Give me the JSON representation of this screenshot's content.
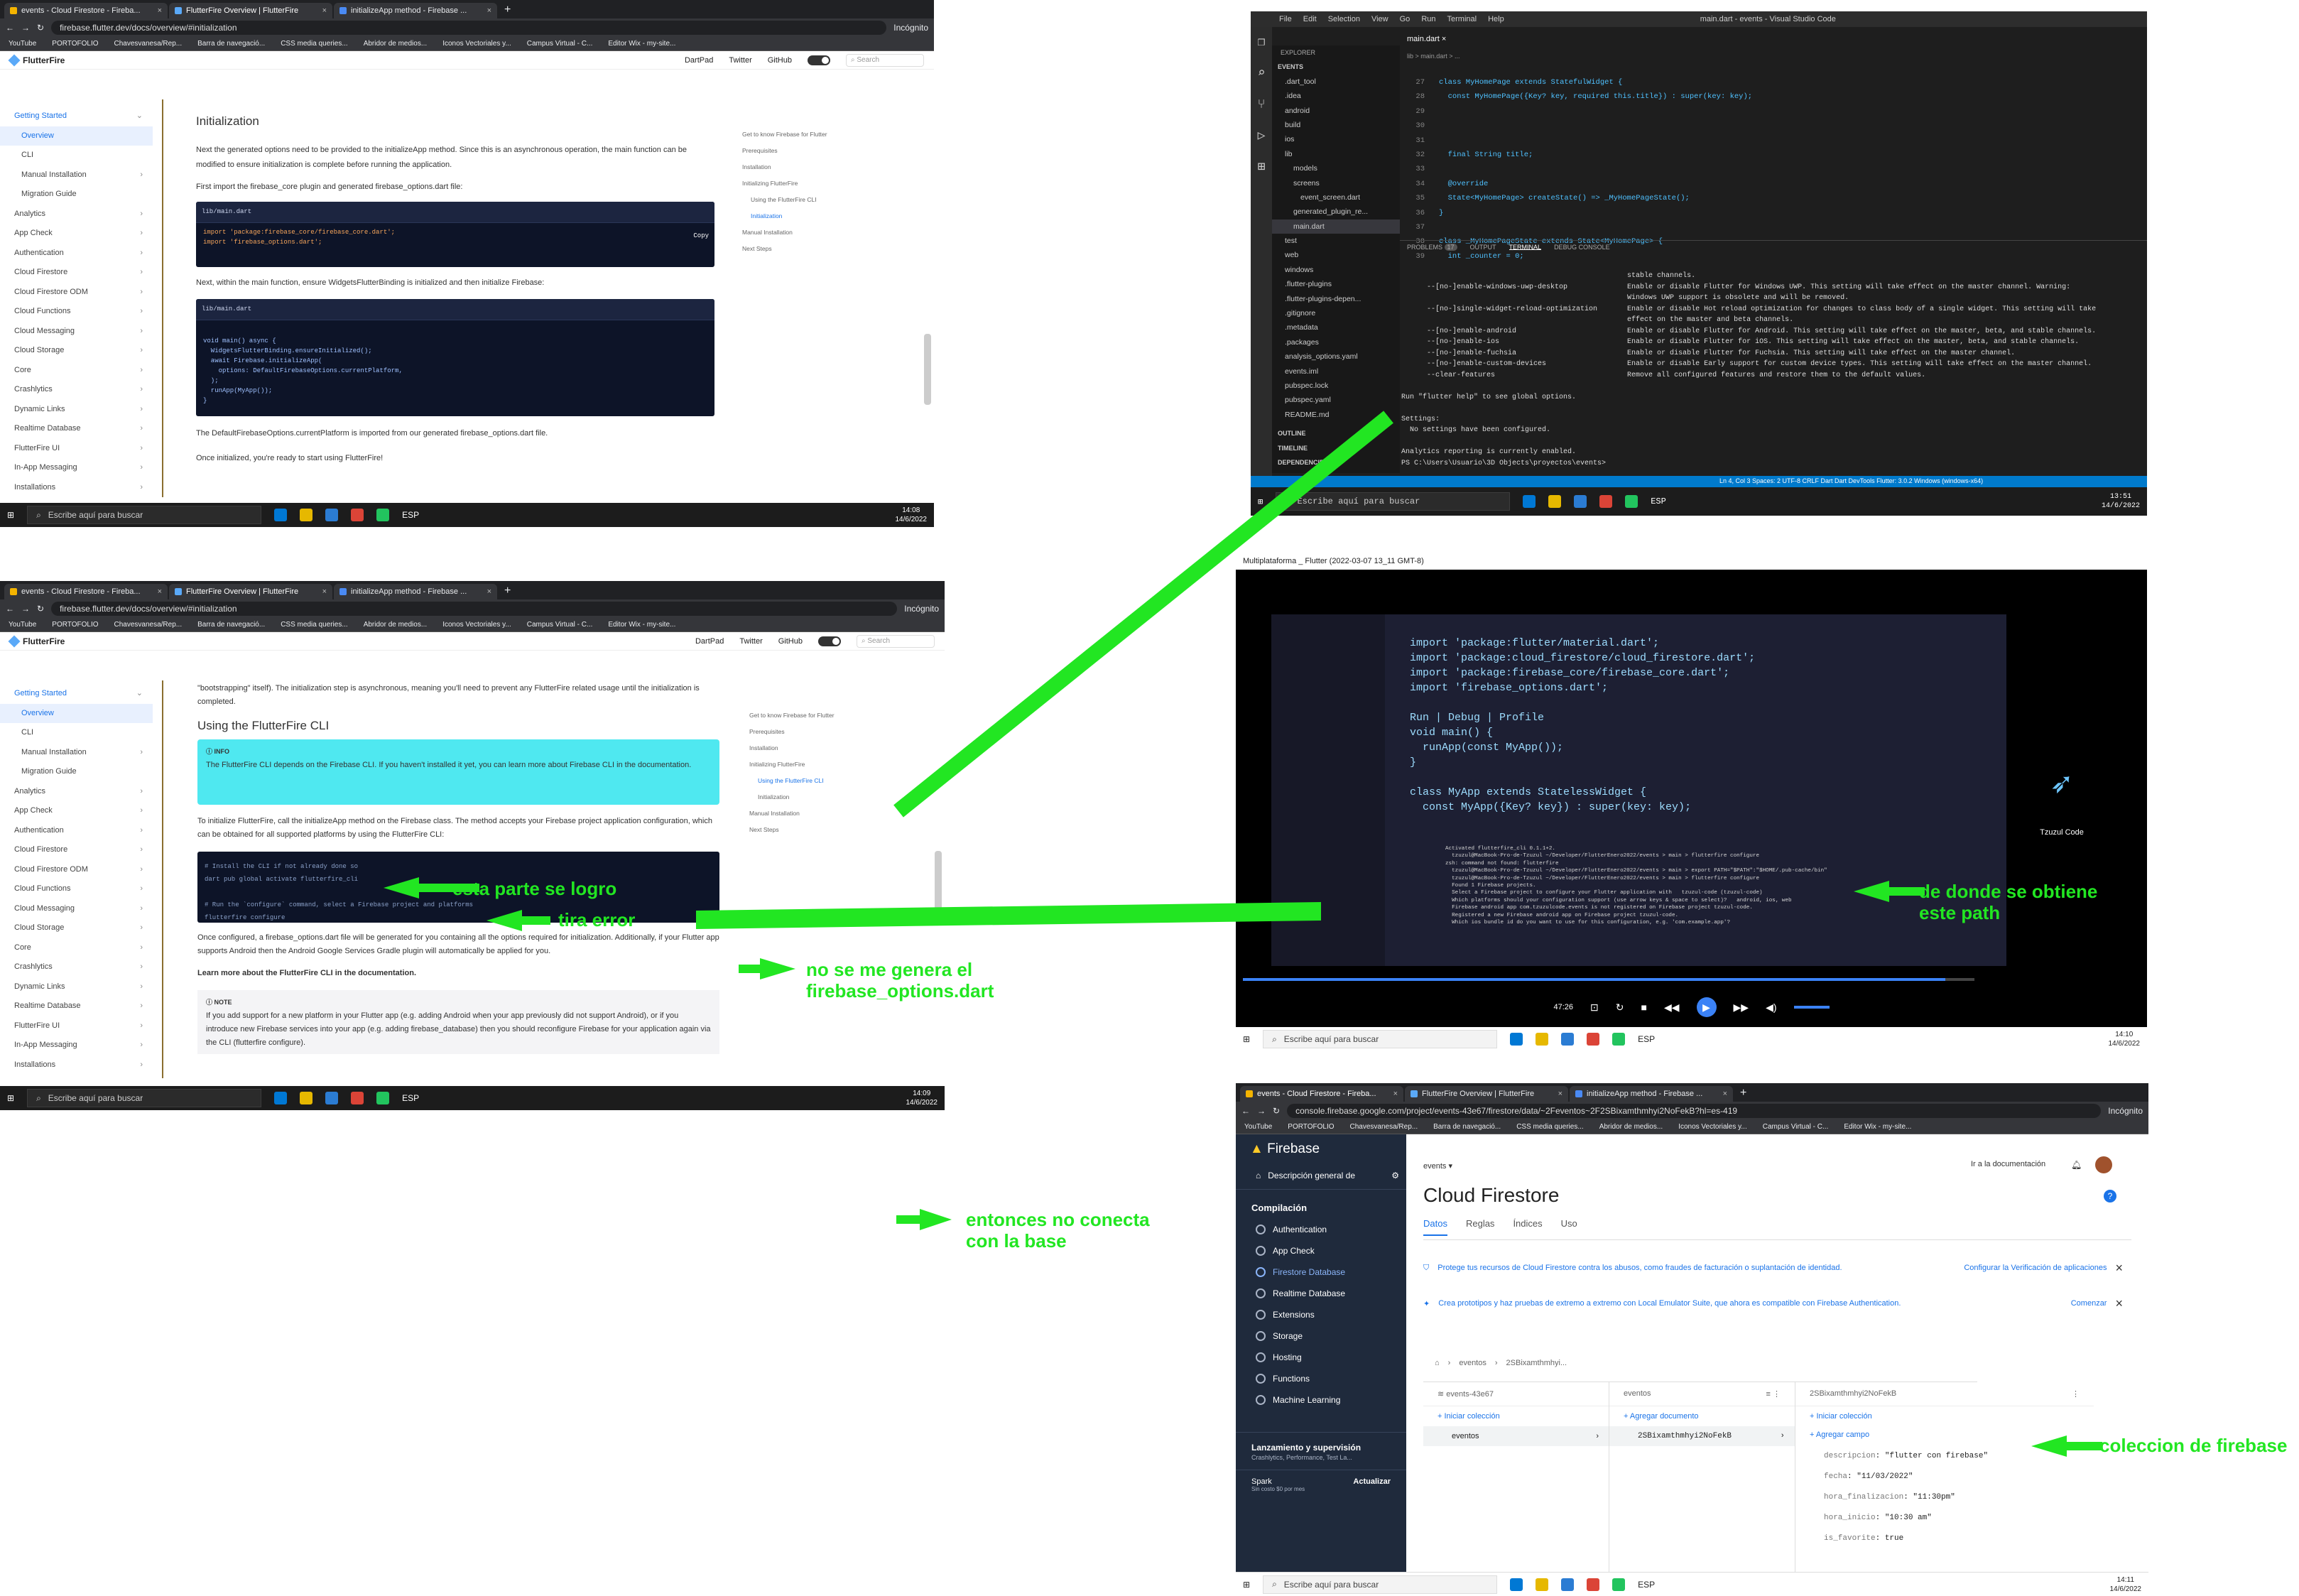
{
  "browser": {
    "tabs": [
      "events - Cloud Firestore - Fireba...",
      "FlutterFire Overview | FlutterFire",
      "initializeApp method - Firebase ..."
    ],
    "url_ff": "firebase.flutter.dev/docs/overview/#initialization",
    "url_fb": "console.firebase.google.com/project/events-43e67/firestore/data/~2Feventos~2F2SBixamthmhyi2NoFekB?hl=es-419",
    "incognito": "Incógnito",
    "bookmarks": [
      "YouTube",
      "PORTOFOLIO",
      "Chavesvanesa/Rep...",
      "Barra de navegació...",
      "CSS media queries...",
      "Abridor de medios...",
      "Iconos Vectoriales y...",
      "Campus Virtual - C...",
      "Editor Wix - my-site..."
    ]
  },
  "flutterfire": {
    "brand": "FlutterFire",
    "nav": [
      "DartPad",
      "Twitter",
      "GitHub"
    ],
    "search": "Search",
    "kbd": "Ctrl K",
    "sidebar": [
      "Getting Started",
      "Overview",
      "CLI",
      "Manual Installation",
      "Migration Guide",
      "Analytics",
      "App Check",
      "Authentication",
      "Cloud Firestore",
      "Cloud Firestore ODM",
      "Cloud Functions",
      "Cloud Messaging",
      "Cloud Storage",
      "Core",
      "Crashlytics",
      "Dynamic Links",
      "Realtime Database",
      "FlutterFire UI",
      "In-App Messaging",
      "Installations"
    ],
    "toc": [
      "Get to know Firebase for Flutter",
      "Prerequisites",
      "Installation",
      "Initializing FlutterFire",
      "Using the FlutterFire CLI",
      "Initialization",
      "Manual Installation",
      "Next Steps"
    ],
    "p1": {
      "heading": "Initialization",
      "t1": "Next the generated options need to be provided to the initializeApp method. Since this is an asynchronous operation, the main function can be modified to ensure initialization is complete before running the application.",
      "t2": "First import the firebase_core plugin and generated firebase_options.dart file:",
      "code1_title": "lib/main.dart",
      "code1": "import 'package:firebase_core/firebase_core.dart';\nimport 'firebase_options.dart';",
      "copy": "Copy",
      "t3": "Next, within the main function, ensure WidgetsFlutterBinding is initialized and then initialize Firebase:",
      "code2_title": "lib/main.dart",
      "code2": "void main() async {\n  WidgetsFlutterBinding.ensureInitialized();\n  await Firebase.initializeApp(\n    options: DefaultFirebaseOptions.currentPlatform,\n  );\n  runApp(MyApp());\n}",
      "t4": "The DefaultFirebaseOptions.currentPlatform is imported from our generated firebase_options.dart file.",
      "t5": "Once initialized, you're ready to start using FlutterFire!"
    },
    "p2": {
      "intro": "\"bootstrapping\" itself). The initialization step is asynchronous, meaning you'll need to prevent any FlutterFire related usage until the initialization is completed.",
      "heading": "Using the FlutterFire CLI",
      "info_label": "INFO",
      "info": "The FlutterFire CLI depends on the Firebase CLI. If you haven't installed it yet, you can learn more about Firebase CLI in the documentation.",
      "t1": "To initialize FlutterFire, call the initializeApp method on the Firebase class. The method accepts your Firebase project application configuration, which can be obtained for all supported platforms by using the FlutterFire CLI:",
      "code": "# Install the CLI if not already done so\ndart pub global activate flutterfire_cli\n\n# Run the `configure` command, select a Firebase project and platforms\nflutterfire configure",
      "t2": "Once configured, a firebase_options.dart file will be generated for you containing all the options required for initialization. Additionally, if your Flutter app supports Android then the Android Google Services Gradle plugin will automatically be applied for you.",
      "t3": "Learn more about the FlutterFire CLI in the documentation.",
      "note_label": "NOTE",
      "note": "If you add support for a new platform in your Flutter app (e.g. adding Android when your app previously did not support Android), or if you introduce new Firebase services into your app (e.g. adding firebase_database) then you should reconfigure Firebase for your application again via the CLI (flutterfire configure)."
    }
  },
  "taskbar": {
    "search": "Escribe aquí para buscar",
    "lang": "ESP",
    "date": "14/6/2022",
    "t1": "14:08",
    "t2": "14:09",
    "t3": "13:51",
    "t4": "14:10",
    "t5": "14:11"
  },
  "vscode": {
    "menu": [
      "File",
      "Edit",
      "Selection",
      "View",
      "Go",
      "Run",
      "Terminal",
      "Help"
    ],
    "title": "main.dart - events - Visual Studio Code",
    "explorer": "EXPLORER",
    "project": "EVENTS",
    "files": [
      ".dart_tool",
      ".idea",
      "android",
      "build",
      "ios",
      "lib",
      "models",
      "screens",
      "event_screen.dart",
      "generated_plugin_re...",
      "main.dart",
      "test",
      "web",
      "windows",
      ".flutter-plugins",
      ".flutter-plugins-depen...",
      ".gitignore",
      ".metadata",
      ".packages",
      "analysis_options.yaml",
      "events.iml",
      "pubspec.lock",
      "pubspec.yaml",
      "README.md"
    ],
    "outline": "OUTLINE",
    "timeline": "TIMELINE",
    "deps": "DEPENDENCIES",
    "editor_tab": "main.dart",
    "breadcrumb": "lib > main.dart > ...",
    "line_numbers": [
      "27",
      "28",
      "29",
      "30",
      "31",
      "32",
      "33",
      "34",
      "35",
      "36",
      "37",
      "38",
      "39"
    ],
    "code": "class MyHomePage extends StatefulWidget {\n  const MyHomePage({Key? key, required this.title}) : super(key: key);\n\n\n\n  final String title;\n\n  @override\n  State<MyHomePage> createState() => _MyHomePageState();\n}\n\nclass _MyHomePageState extends State<MyHomePage> {\n  int _counter = 0;",
    "panel_tabs": [
      "PROBLEMS",
      "OUTPUT",
      "TERMINAL",
      "DEBUG CONSOLE"
    ],
    "problems": "17",
    "terminal": "                                                     stable channels.\n      --[no-]enable-windows-uwp-desktop              Enable or disable Flutter for Windows UWP. This setting will take effect on the master channel. Warning:\n                                                     Windows UWP support is obsolete and will be removed.\n      --[no-]single-widget-reload-optimization       Enable or disable Hot reload optimization for changes to class body of a single widget. This setting will take\n                                                     effect on the master and beta channels.\n      --[no-]enable-android                          Enable or disable Flutter for Android. This setting will take effect on the master, beta, and stable channels.\n      --[no-]enable-ios                              Enable or disable Flutter for iOS. This setting will take effect on the master, beta, and stable channels.\n      --[no-]enable-fuchsia                          Enable or disable Flutter for Fuchsia. This setting will take effect on the master channel.\n      --[no-]enable-custom-devices                   Enable or disable Early support for custom device types. This setting will take effect on the master channel.\n      --clear-features                               Remove all configured features and restore them to the default values.\n\nRun \"flutter help\" to see global options.\n\nSettings:\n  No settings have been configured.\n\nAnalytics reporting is currently enabled.\nPS C:\\Users\\Usuario\\3D Objects\\proyectos\\events>",
    "status": "Ln 4, Col 3   Spaces: 2   UTF-8   CRLF   Dart   Dart DevTools   Flutter: 3.0.2   Windows (windows-x64)"
  },
  "video": {
    "title": "Multiplataforma _ Flutter (2022-03-07 13_11 GMT-8)",
    "code": "import 'package:flutter/material.dart';\nimport 'package:cloud_firestore/cloud_firestore.dart';\nimport 'package:firebase_core/firebase_core.dart';\nimport 'firebase_options.dart';\n\nRun | Debug | Profile\nvoid main() {\n  runApp(const MyApp());\n}\n\nclass MyApp extends StatelessWidget {\n  const MyApp({Key? key}) : super(key: key);\n",
    "terminal": "Activated flutterfire_cli 0.1.1+2.\n  tzuzul@MacBook-Pro-de-Tzuzul ~/Developer/FlutterEnero2022/events > main > flutterfire configure\nzsh: command not found: flutterfire\n  tzuzul@MacBook-Pro-de-Tzuzul ~/Developer/FlutterEnero2022/events > main > export PATH=\"$PATH\":\"$HOME/.pub-cache/bin\"\n  tzuzul@MacBook-Pro-de-Tzuzul ~/Developer/FlutterEnero2022/events > main > flutterfire configure\n  Found 1 Firebase projects.\n  Select a Firebase project to configure your Flutter application with   tzuzul-code (tzuzul-code)\n  Which platforms should your configuration support (use arrow keys & space to select)?   android, ios, web\n  Firebase android app com.tzuzulcode.events is not registered on Firebase project tzuzul-code.\n  Registered a new Firebase android app on Firebase project tzuzul-code.\n  Which ios bundle id do you want to use for this configuration, e.g. 'com.example.app'?",
    "channel": "Tzuzul Code",
    "time": "47:26"
  },
  "firebase": {
    "brand": "Firebase",
    "overview": "Descripción general de",
    "build": "Compilación",
    "nav": [
      "Authentication",
      "App Check",
      "Firestore Database",
      "Realtime Database",
      "Extensions",
      "Storage",
      "Hosting",
      "Functions",
      "Machine Learning"
    ],
    "release": "Lanzamiento y supervisión",
    "release_sub": "Crashlytics, Performance, Test La...",
    "plan": "Spark",
    "plan_sub": "Sin costo $0 por mes",
    "upgrade": "Actualizar",
    "project": "events",
    "docs": "Ir a la documentación",
    "title": "Cloud Firestore",
    "tabs": [
      "Datos",
      "Reglas",
      "Índices",
      "Uso"
    ],
    "banner1": "Protege tus recursos de Cloud Firestore contra los abusos, como fraudes de facturación o suplantación de identidad.",
    "banner1_link": "Configurar la Verificación de aplicaciones",
    "banner2": "Crea prototipos y haz pruebas de extremo a extremo con Local Emulator Suite, que ahora es compatible con Firebase Authentication.",
    "banner2_link": "Comenzar",
    "path": [
      "eventos",
      "2SBixamthmhyi..."
    ],
    "col1": "events-43e67",
    "col2": "eventos",
    "col3": "2SBixamthmhyi2NoFekB",
    "add_col": "+ Iniciar colección",
    "add_doc": "+ Agregar documento",
    "add_col2": "+ Iniciar colección",
    "add_field": "+ Agregar campo",
    "collection": "eventos",
    "document": "2SBixamthmhyi2NoFekB",
    "fields": [
      {
        "k": "descripcion",
        "v": "\"flutter con firebase\""
      },
      {
        "k": "fecha",
        "v": "\"11/03/2022\""
      },
      {
        "k": "hora_finalizacion",
        "v": "\"11:30pm\""
      },
      {
        "k": "hora_inicio",
        "v": "\"10:30 am\""
      },
      {
        "k": "is_favorite",
        "v": "true"
      }
    ]
  },
  "annotations": {
    "a1": "esta parte se logro",
    "a2": "tira error",
    "a3": "no se me genera el\nfirebase_options.dart",
    "a4": "de donde se obtiene\neste path",
    "a5": "entonces no conecta\ncon la base",
    "a6": "coleccion de firebase"
  },
  "colors": {
    "annotation": "#22e622",
    "vscode_status": "#007acc",
    "firebase_nav": "#1f2a3c",
    "info_box": "#4fe8f0"
  }
}
